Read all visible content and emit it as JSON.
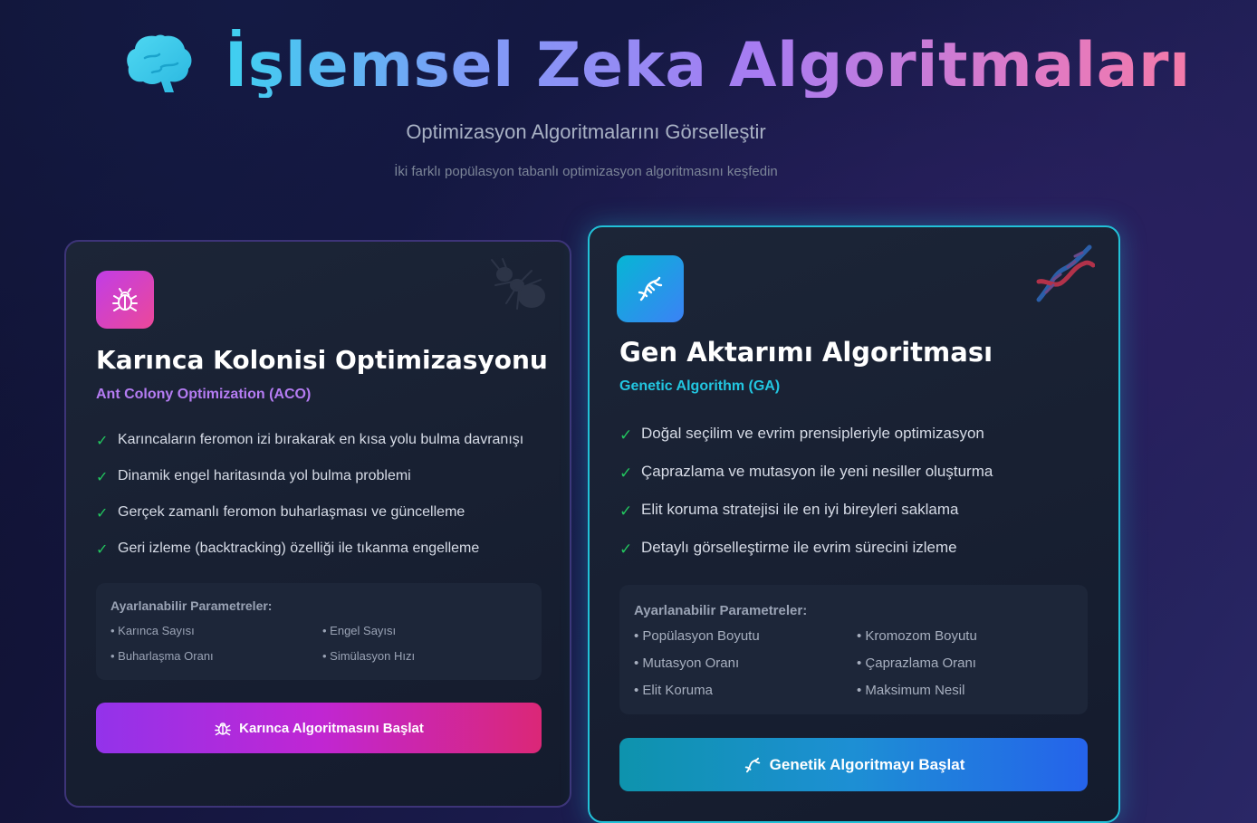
{
  "header": {
    "title": "İşlemsel Zeka Algoritmaları",
    "brain_icon": "brain-icon",
    "subtitle": "Optimizasyon Algoritmalarını Görselleştir",
    "description": "İki farklı popülasyon tabanlı optimizasyon algoritmasını keşfedin"
  },
  "aco": {
    "icon": "bug-icon",
    "deco_icon": "ant-icon",
    "title": "Karınca Kolonisi Optimizasyonu",
    "subtitle": "Ant Colony Optimization (ACO)",
    "check_mark": "✓",
    "features": [
      "Karıncaların feromon izi bırakarak en kısa yolu bulma davranışı",
      "Dinamik engel haritasında yol bulma problemi",
      "Gerçek zamanlı feromon buharlaşması ve güncelleme",
      "Geri izleme (backtracking) özelliği ile tıkanma engelleme"
    ],
    "params_title": "Ayarlanabilir Parametreler:",
    "params": [
      "• Karınca Sayısı",
      "• Engel Sayısı",
      "• Buharlaşma Oranı",
      "• Simülasyon Hızı"
    ],
    "button_label": "Karınca Algoritmasını Başlat",
    "accent": "#b57cf3"
  },
  "ga": {
    "icon": "dna-icon",
    "deco_icon": "dna-helix-icon",
    "title": "Gen Aktarımı Algoritması",
    "subtitle": "Genetic Algorithm (GA)",
    "check_mark": "✓",
    "features": [
      "Doğal seçilim ve evrim prensipleriyle optimizasyon",
      "Çaprazlama ve mutasyon ile yeni nesiller oluşturma",
      "Elit koruma stratejisi ile en iyi bireyleri saklama",
      "Detaylı görselleştirme ile evrim sürecini izleme"
    ],
    "params_title": "Ayarlanabilir Parametreler:",
    "params": [
      "• Popülasyon Boyutu",
      "• Kromozom Boyutu",
      "• Mutasyon Oranı",
      "• Çaprazlama Oranı",
      "• Elit Koruma",
      "• Maksimum Nesil"
    ],
    "button_label": "Genetik Algoritmayı Başlat",
    "accent": "#22c6e0"
  }
}
